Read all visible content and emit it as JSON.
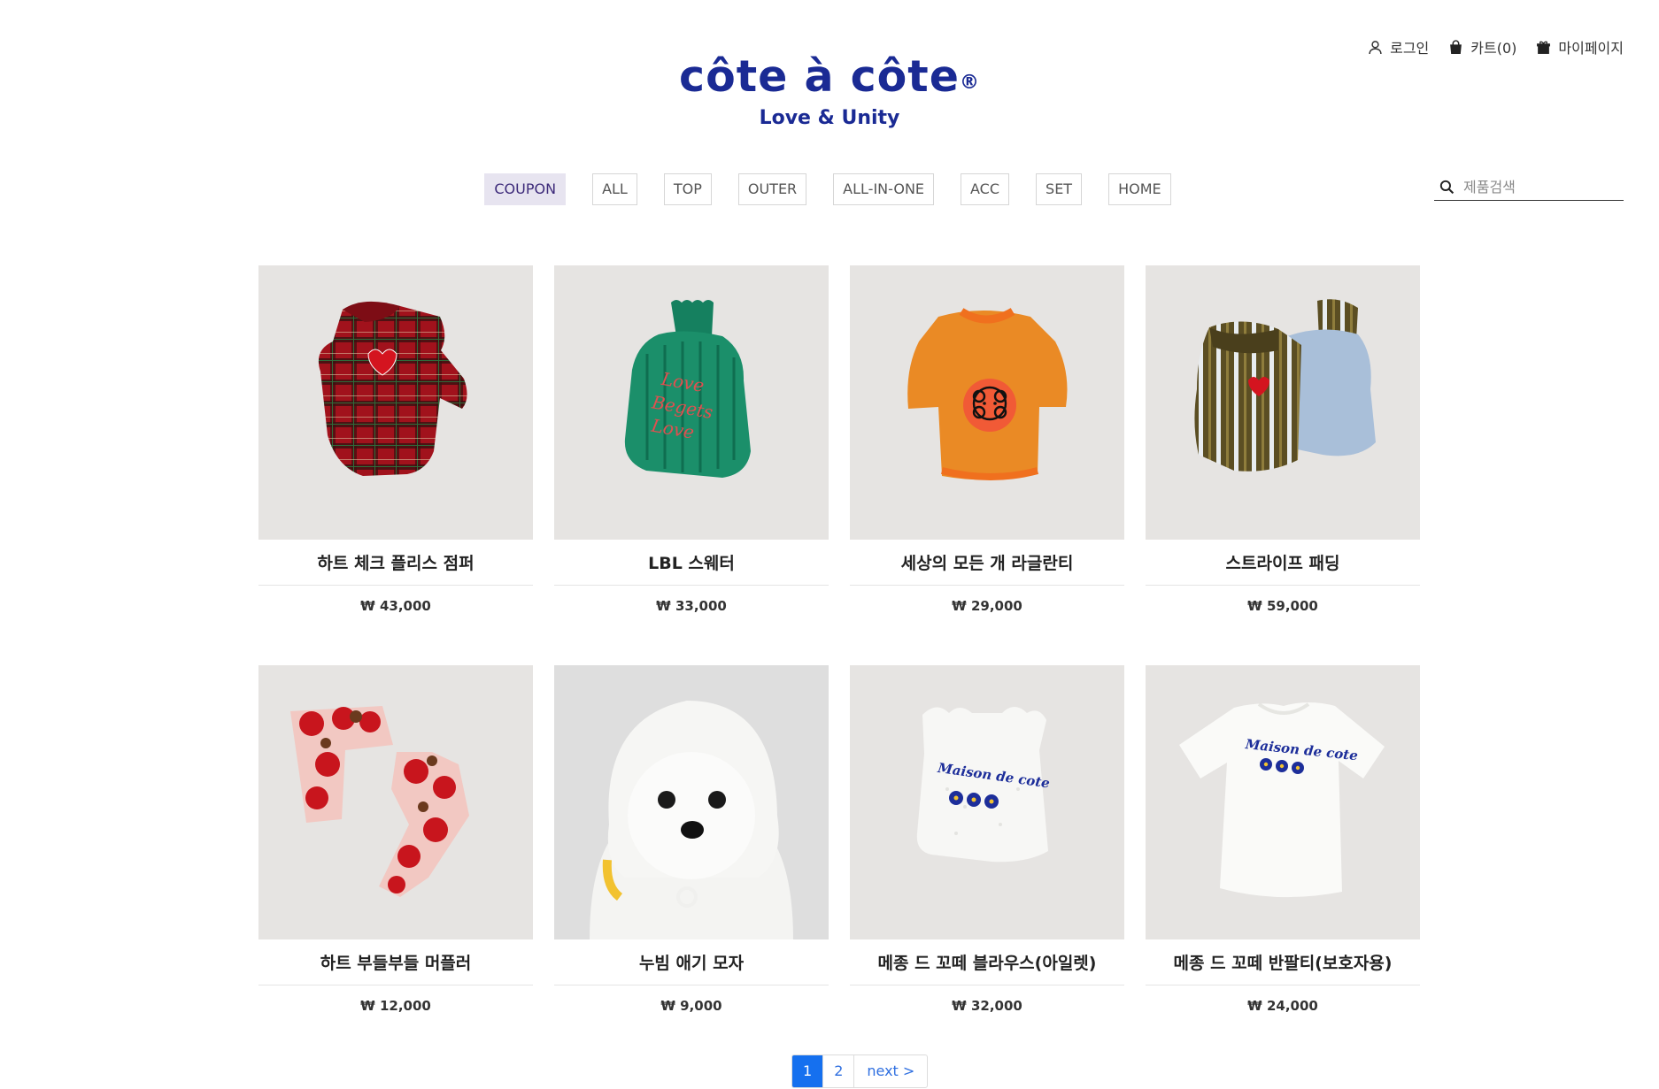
{
  "header": {
    "links": [
      {
        "label": "로그인",
        "icon": "user-icon"
      },
      {
        "label": "카트(0)",
        "icon": "bag-icon"
      },
      {
        "label": "마이페이지",
        "icon": "gift-icon"
      }
    ],
    "brand": "côte à côte",
    "brand_mark": "®",
    "tagline": "Love & Unity"
  },
  "nav": {
    "items": [
      "COUPON",
      "ALL",
      "TOP",
      "OUTER",
      "ALL-IN-ONE",
      "ACC",
      "SET",
      "HOME"
    ],
    "active": "COUPON"
  },
  "search": {
    "placeholder": "제품검색",
    "icon": "search-icon"
  },
  "products": [
    {
      "name": "하트 체크 플리스 점퍼",
      "price": "₩ 43,000"
    },
    {
      "name": "LBL 스웨터",
      "price": "₩ 33,000"
    },
    {
      "name": "세상의 모든 개 라글란티",
      "price": "₩ 29,000"
    },
    {
      "name": "스트라이프 패딩",
      "price": "₩ 59,000"
    },
    {
      "name": "하트 부들부들 머플러",
      "price": "₩ 12,000"
    },
    {
      "name": "누빔 애기 모자",
      "price": "₩ 9,000"
    },
    {
      "name": "메종 드 꼬떼 블라우스(아일렛)",
      "price": "₩ 32,000"
    },
    {
      "name": "메종 드 꼬떼 반팔티(보호자용)",
      "price": "₩ 24,000"
    }
  ],
  "pagination": {
    "pages": [
      "1",
      "2"
    ],
    "current": "1",
    "next_label": "next >"
  },
  "colors": {
    "brand": "#1a2a94",
    "active_nav_bg": "#e7e4f0",
    "pager_active": "#1570ef",
    "thumb_bg": "#e6e4e2"
  }
}
